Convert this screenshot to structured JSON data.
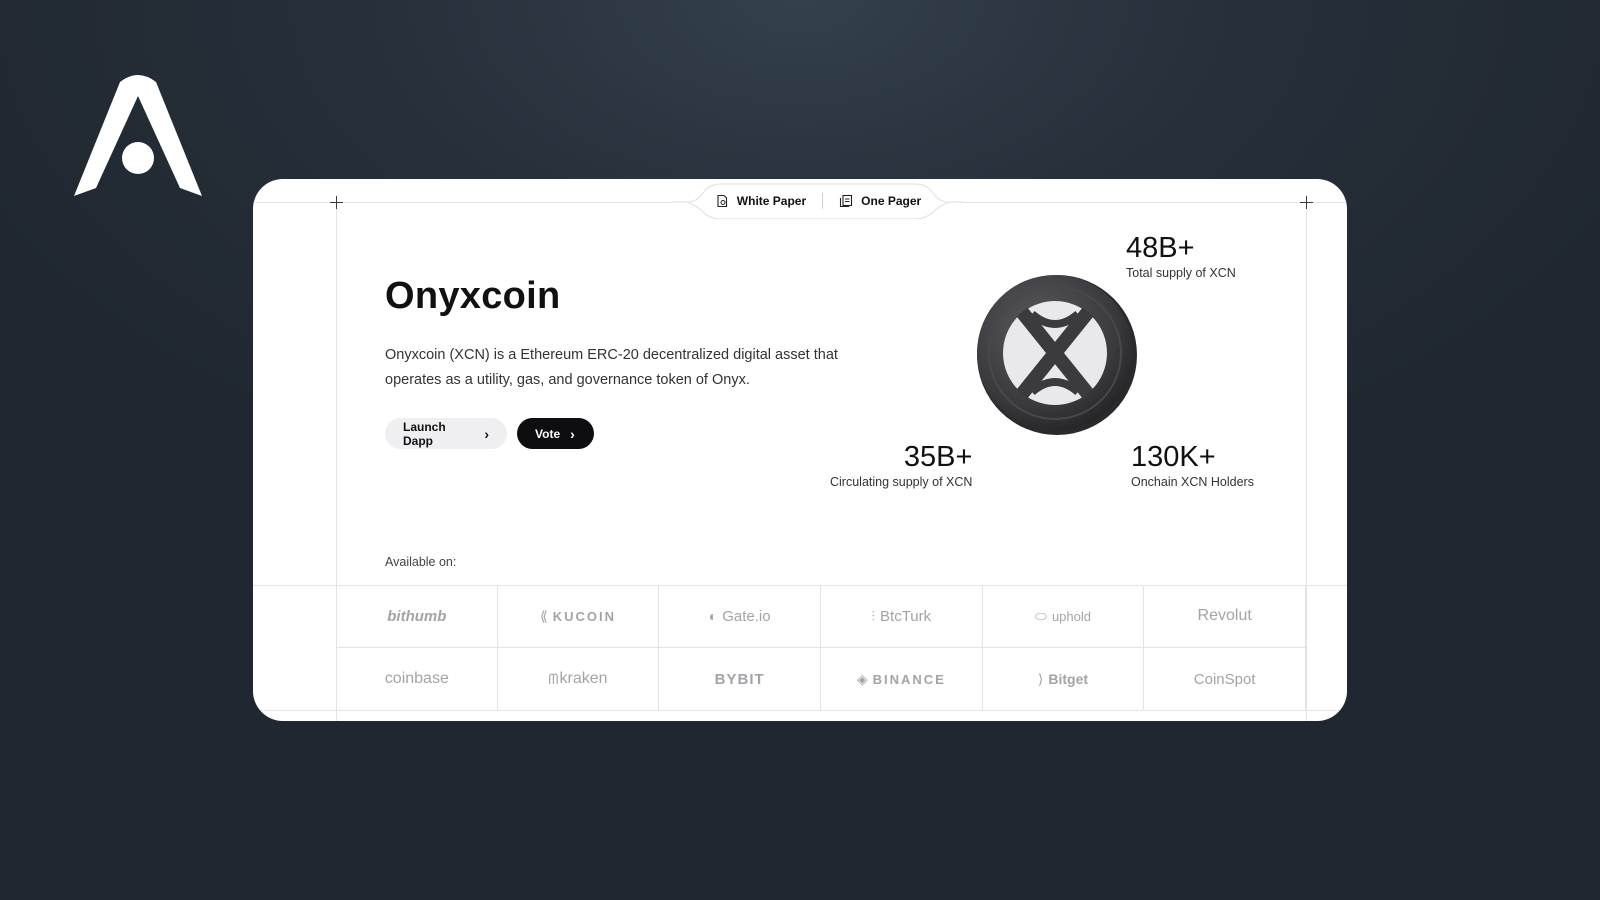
{
  "doc_tabs": [
    {
      "label": "White Paper",
      "icon": "document-icon"
    },
    {
      "label": "One Pager",
      "icon": "pages-icon"
    }
  ],
  "hero": {
    "title": "Onyxcoin",
    "description": "Onyxcoin (XCN) is a Ethereum ERC-20 decentralized digital asset that operates as a utility, gas, and governance token of Onyx."
  },
  "buttons": {
    "launch_label": "Launch Dapp",
    "vote_label": "Vote"
  },
  "stats": {
    "total": {
      "value": "48B+",
      "label": "Total supply of XCN"
    },
    "circulating": {
      "value": "35B+",
      "label": "Circulating supply of XCN"
    },
    "holders": {
      "value": "130K+",
      "label": "Onchain XCN Holders"
    }
  },
  "available_label": "Available on:",
  "exchanges": [
    {
      "name": "bithumb",
      "icon": ""
    },
    {
      "name": "KUCOIN",
      "icon": "kucoin-icon"
    },
    {
      "name": "Gate.io",
      "icon": "gate-icon"
    },
    {
      "name": "BtcTurk",
      "icon": "btcturk-icon"
    },
    {
      "name": "uphold",
      "icon": "uphold-icon"
    },
    {
      "name": "Revolut",
      "icon": ""
    },
    {
      "name": "coinbase",
      "icon": ""
    },
    {
      "name": "kraken",
      "icon": "kraken-icon"
    },
    {
      "name": "BYBIT",
      "icon": ""
    },
    {
      "name": "BINANCE",
      "icon": "binance-icon"
    },
    {
      "name": "Bitget",
      "icon": "bitget-icon"
    },
    {
      "name": "CoinSpot",
      "icon": ""
    }
  ],
  "colors": {
    "background": "#232a33",
    "card": "#ffffff",
    "primary_button": "#0e0e10",
    "secondary_button": "#efeff1",
    "logo_muted": "#a3a3a8"
  }
}
